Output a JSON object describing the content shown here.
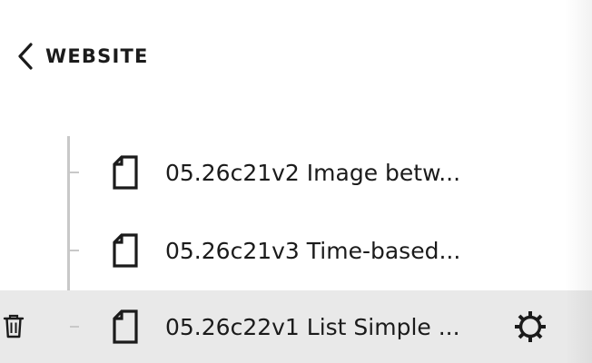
{
  "header": {
    "back_icon": "chevron-left-icon",
    "title": "WEBSITE"
  },
  "pages": [
    {
      "label": "05.26c21v2 Image betw...",
      "icon": "page-icon",
      "selected": false
    },
    {
      "label": "05.26c21v3 Time-based...",
      "icon": "page-icon",
      "selected": false
    },
    {
      "label": "05.26c22v1 List Simple ...",
      "icon": "page-icon",
      "selected": true,
      "actions": [
        "trash-icon",
        "gear-icon"
      ]
    }
  ],
  "colors": {
    "selected_row": "#e9e9e9",
    "tree_line": "#c8c8c8",
    "text": "#1b1b1b"
  }
}
